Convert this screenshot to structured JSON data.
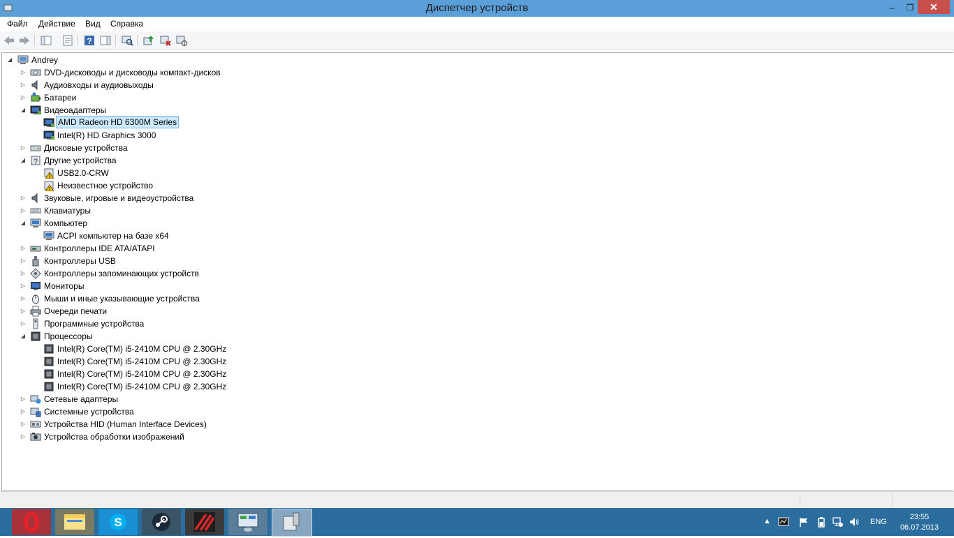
{
  "window": {
    "title": "Диспетчер устройств",
    "minimize_symbol": "‒",
    "maximize_symbol": "❐",
    "close_symbol": "✕"
  },
  "menu": [
    "Файл",
    "Действие",
    "Вид",
    "Справка"
  ],
  "toolbar": {
    "icons": [
      "back-icon",
      "forward-icon",
      "console-tree-icon",
      "properties-icon",
      "help-icon",
      "action-pane-icon",
      "scan-hardware-icon",
      "update-driver-icon",
      "uninstall-device-icon",
      "disable-device-icon"
    ]
  },
  "tree": {
    "root": "Andrey",
    "nodes": [
      {
        "label": "DVD-дисководы и дисководы компакт-дисков",
        "level": 1,
        "state": "collapsed",
        "icon": "dvd-drive-icon"
      },
      {
        "label": "Аудиовходы и аудиовыходы",
        "level": 1,
        "state": "collapsed",
        "icon": "speaker-icon"
      },
      {
        "label": "Батареи",
        "level": 1,
        "state": "collapsed",
        "icon": "battery-icon"
      },
      {
        "label": "Видеоадаптеры",
        "level": 1,
        "state": "expanded",
        "icon": "display-adapter-icon"
      },
      {
        "label": "AMD Radeon HD 6300M Series",
        "level": 2,
        "state": "leaf",
        "icon": "display-adapter-icon",
        "selected": true
      },
      {
        "label": "Intel(R) HD Graphics 3000",
        "level": 2,
        "state": "leaf",
        "icon": "display-adapter-icon"
      },
      {
        "label": "Дисковые устройства",
        "level": 1,
        "state": "collapsed",
        "icon": "disk-drive-icon"
      },
      {
        "label": "Другие устройства",
        "level": 1,
        "state": "expanded",
        "icon": "unknown-device-icon"
      },
      {
        "label": "USB2.0-CRW",
        "level": 2,
        "state": "leaf",
        "icon": "warning-device-icon"
      },
      {
        "label": "Неизвестное устройство",
        "level": 2,
        "state": "leaf",
        "icon": "warning-device-icon"
      },
      {
        "label": "Звуковые, игровые и видеоустройства",
        "level": 1,
        "state": "collapsed",
        "icon": "speaker-icon"
      },
      {
        "label": "Клавиатуры",
        "level": 1,
        "state": "collapsed",
        "icon": "keyboard-icon"
      },
      {
        "label": "Компьютер",
        "level": 1,
        "state": "expanded",
        "icon": "computer-icon"
      },
      {
        "label": "ACPI компьютер на базе x64",
        "level": 2,
        "state": "leaf",
        "icon": "computer-icon"
      },
      {
        "label": "Контроллеры IDE ATA/ATAPI",
        "level": 1,
        "state": "collapsed",
        "icon": "ide-controller-icon"
      },
      {
        "label": "Контроллеры USB",
        "level": 1,
        "state": "collapsed",
        "icon": "usb-icon"
      },
      {
        "label": "Контроллеры запоминающих устройств",
        "level": 1,
        "state": "collapsed",
        "icon": "storage-controller-icon"
      },
      {
        "label": "Мониторы",
        "level": 1,
        "state": "collapsed",
        "icon": "monitor-icon"
      },
      {
        "label": "Мыши и иные указывающие устройства",
        "level": 1,
        "state": "collapsed",
        "icon": "mouse-icon"
      },
      {
        "label": "Очереди печати",
        "level": 1,
        "state": "collapsed",
        "icon": "printer-icon"
      },
      {
        "label": "Программные устройства",
        "level": 1,
        "state": "collapsed",
        "icon": "software-device-icon"
      },
      {
        "label": "Процессоры",
        "level": 1,
        "state": "expanded",
        "icon": "processor-icon"
      },
      {
        "label": "Intel(R) Core(TM) i5-2410M CPU @ 2.30GHz",
        "level": 2,
        "state": "leaf",
        "icon": "processor-icon"
      },
      {
        "label": "Intel(R) Core(TM) i5-2410M CPU @ 2.30GHz",
        "level": 2,
        "state": "leaf",
        "icon": "processor-icon"
      },
      {
        "label": "Intel(R) Core(TM) i5-2410M CPU @ 2.30GHz",
        "level": 2,
        "state": "leaf",
        "icon": "processor-icon"
      },
      {
        "label": "Intel(R) Core(TM) i5-2410M CPU @ 2.30GHz",
        "level": 2,
        "state": "leaf",
        "icon": "processor-icon"
      },
      {
        "label": "Сетевые адаптеры",
        "level": 1,
        "state": "collapsed",
        "icon": "network-adapter-icon"
      },
      {
        "label": "Системные устройства",
        "level": 1,
        "state": "collapsed",
        "icon": "system-device-icon"
      },
      {
        "label": "Устройства HID (Human Interface Devices)",
        "level": 1,
        "state": "collapsed",
        "icon": "hid-icon"
      },
      {
        "label": "Устройства обработки изображений",
        "level": 1,
        "state": "collapsed",
        "icon": "imaging-device-icon"
      }
    ]
  },
  "taskbar": {
    "apps": [
      "opera-icon",
      "file-explorer-icon",
      "skype-icon",
      "steam-icon",
      "game-app-icon",
      "control-panel-icon",
      "device-manager-icon"
    ],
    "tray_language": "ENG",
    "tray_icons": [
      "show-hidden-icons-icon",
      "tray-app-icon",
      "action-center-flag-icon",
      "power-icon",
      "network-icon",
      "volume-icon"
    ],
    "time": "23:55",
    "date": "06.07.2013"
  },
  "colors": {
    "titlebar": "#5a9fd8",
    "close_button": "#c7504a",
    "taskbar": "#2b6e9e",
    "selection": "#cce8ff"
  }
}
